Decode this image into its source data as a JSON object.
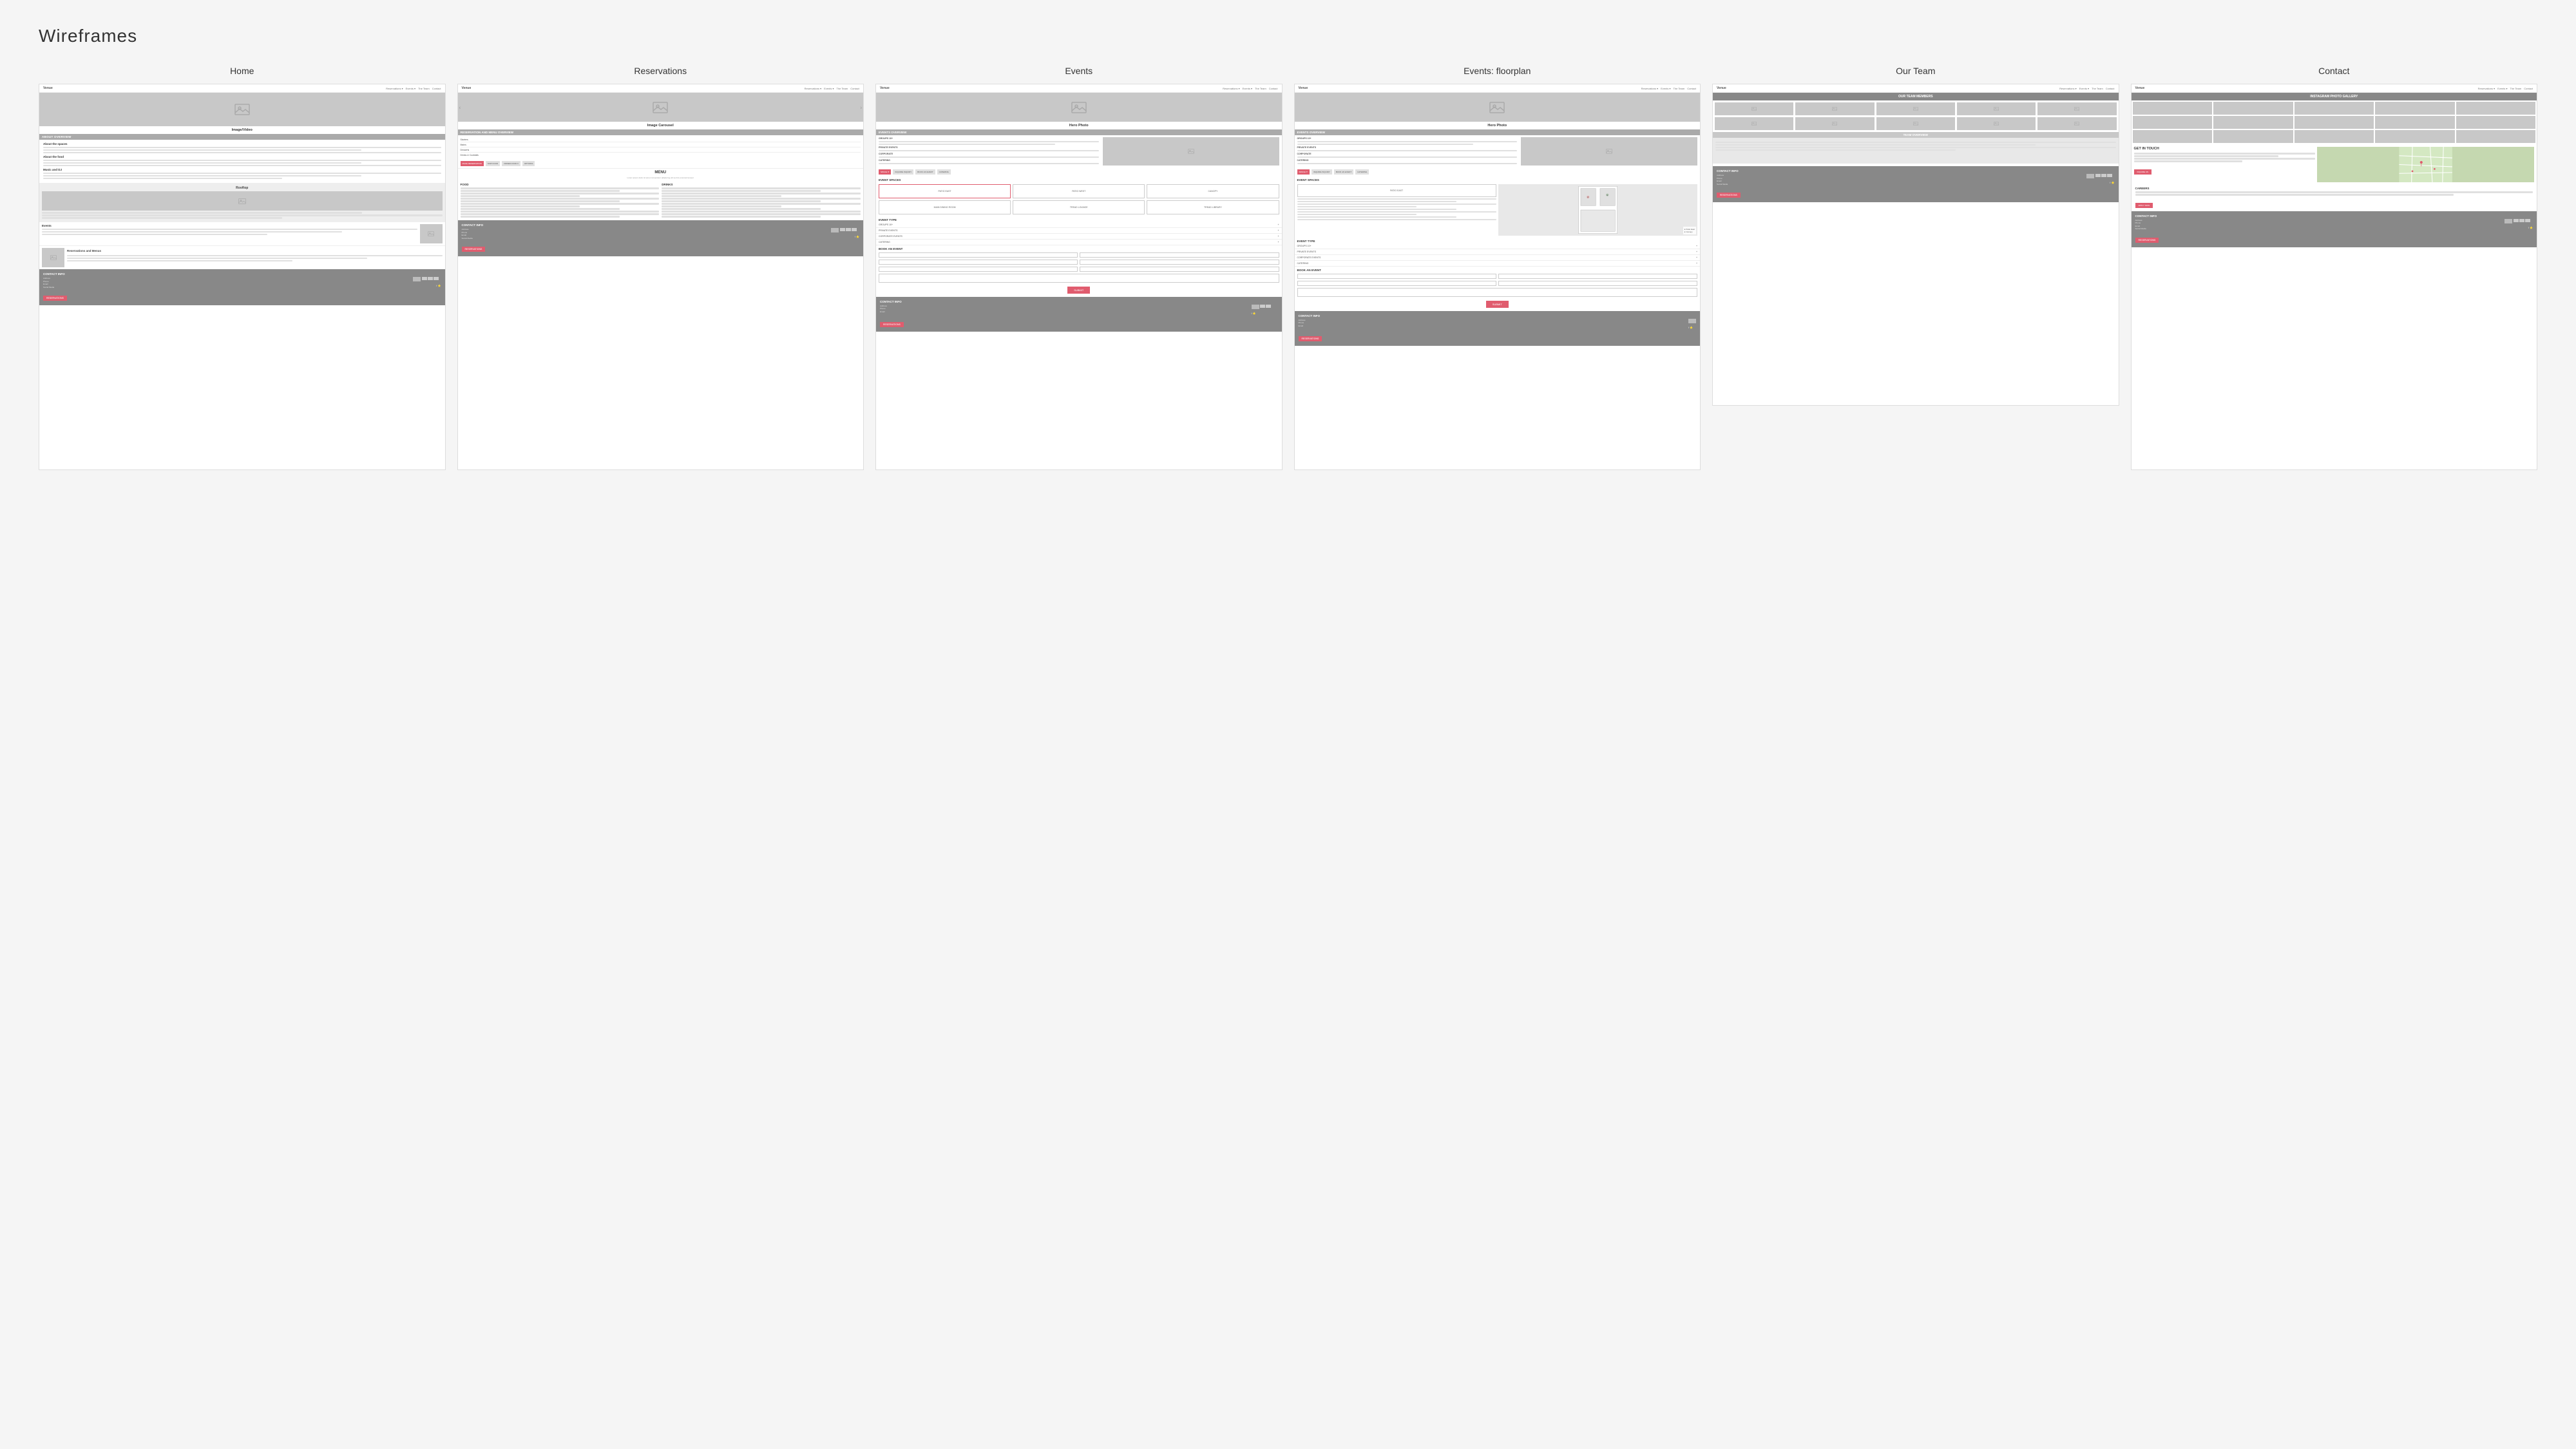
{
  "page": {
    "title": "Wireframes"
  },
  "columns": [
    {
      "id": "home",
      "title": "Home",
      "nav": {
        "logo": "Venue",
        "links": [
          "Reservations ▾",
          "Events ▾",
          "The Team",
          "Contact"
        ]
      },
      "hero": {
        "label": "Image/Video",
        "type": "image"
      },
      "sections": [
        {
          "type": "header",
          "text": "ABOUT OVERVIEW"
        },
        {
          "type": "about-items",
          "items": [
            {
              "label": "About the spaces",
              "lines": 3
            },
            {
              "label": "About the food",
              "lines": 3
            },
            {
              "label": "Music and DJ",
              "lines": 3
            }
          ]
        },
        {
          "type": "rooftop",
          "label": "Rooftop",
          "hasImage": true
        },
        {
          "type": "events-preview",
          "label": "Events",
          "hasImage": true
        },
        {
          "type": "reservations-preview",
          "label": "Reservations and Menus",
          "hasImage": true
        }
      ],
      "footer": {
        "title": "CONTACT INFO",
        "address": "Address\nPhone\nEmail\nSocial Media",
        "hasSocial": true,
        "hasReserveBtn": true
      }
    },
    {
      "id": "reservations",
      "title": "Reservations",
      "nav": {
        "logo": "Venue",
        "links": [
          "Reservations ▾",
          "Events ▾",
          "The Team",
          "Contact"
        ]
      },
      "hero": {
        "label": "Image Carousel",
        "type": "carousel"
      },
      "sections": [
        {
          "type": "header",
          "text": "RESERVATION AND MENU OVERVIEW"
        },
        {
          "type": "dropdown-items",
          "items": [
            "Starters",
            "Mains",
            "Desserts",
            "Drinks & Cocktails"
          ]
        },
        {
          "type": "btn-row",
          "buttons": [
            "MAKE RESERVATION",
            "SKIP FOOD",
            "ORDER FOOD ▾",
            "OPTIONS"
          ]
        },
        {
          "type": "menu-header",
          "text": "MENU"
        },
        {
          "type": "two-col-menu",
          "left": "FOOD",
          "right": "DRINKS"
        }
      ],
      "footer": {
        "title": "CONTACT INFO",
        "address": "Address\nPhone\nEmail\nSocial Media",
        "hasSocial": true,
        "hasReserveBtn": true
      }
    },
    {
      "id": "events",
      "title": "Events",
      "nav": {
        "logo": "Venue",
        "links": [
          "Reservations ▾",
          "Events ▾",
          "The Team",
          "Contact"
        ]
      },
      "hero": {
        "label": "Hero Photo",
        "type": "image"
      },
      "sections": [
        {
          "type": "header",
          "text": "EVENTS OVERVIEW"
        },
        {
          "type": "event-overview-items"
        },
        {
          "type": "btn-row-small",
          "buttons": [
            "SPACE IT",
            "INQUIRE INQUIRY",
            "BOOK AN EVENT",
            "CATERING"
          ]
        },
        {
          "type": "event-spaces-title",
          "text": "EVENT SPACES"
        },
        {
          "type": "event-spaces-grid",
          "spaces": [
            "PATIO EAST",
            "PATIO WEST",
            "CANOPY",
            "MAIN DINING ROOM",
            "TREAD LOUNGE",
            "TREAD LIBRARY"
          ]
        },
        {
          "type": "event-type-title",
          "text": "EVENT TYPE"
        },
        {
          "type": "accordion",
          "items": [
            "GROUPS 10+",
            "PRIVATE EVENTS",
            "CORPORATE EVENTS",
            "CATERING"
          ]
        },
        {
          "type": "book-title",
          "text": "BOOK AN EVENT"
        },
        {
          "type": "event-form"
        }
      ],
      "footer": {
        "title": "CONTACT INFO",
        "hasReserveBtn": true
      }
    },
    {
      "id": "events-floorplan",
      "title": "Events: floorplan",
      "nav": {
        "logo": "Venue",
        "links": [
          "Reservations ▾",
          "Events ▾",
          "The Team",
          "Contact"
        ]
      },
      "hero": {
        "label": "Hero Photo",
        "type": "image"
      },
      "sections": [
        {
          "type": "header",
          "text": "EVENTS OVERVIEW"
        },
        {
          "type": "event-overview-items"
        },
        {
          "type": "btn-row-small",
          "buttons": [
            "SPACE IT",
            "INQUIRE INQUIRY",
            "BOOK AN EVENT",
            "CATERING"
          ]
        },
        {
          "type": "event-spaces-title",
          "text": "EVENT SPACES"
        },
        {
          "type": "event-floorplan-split"
        },
        {
          "type": "event-type-title",
          "text": "EVENT TYPE"
        },
        {
          "type": "accordion",
          "items": [
            "GROUPS 10+",
            "PRIVATE EVENTS",
            "CORPORATE EVENTS",
            "CATERING"
          ]
        },
        {
          "type": "book-title",
          "text": "BOOK AN EVENT"
        },
        {
          "type": "event-form"
        }
      ],
      "footer": {
        "title": "CONTACT INFO",
        "hasReserveBtn": true
      }
    },
    {
      "id": "our-team",
      "title": "Our Team",
      "nav": {
        "logo": "Venue",
        "links": [
          "Reservations ▾",
          "Events ▾",
          "The Team",
          "Contact"
        ]
      },
      "sections": [
        {
          "type": "dark-header",
          "text": "OUR TEAM MEMBERS"
        },
        {
          "type": "team-grid-3x3"
        },
        {
          "type": "team-overview-header",
          "text": "TEAM OVERVIEW"
        },
        {
          "type": "team-overview-text"
        }
      ],
      "footer": {
        "title": "CONTACT INFO",
        "hasSocial": true,
        "hasReserveBtn": true
      }
    },
    {
      "id": "contact",
      "title": "Contact",
      "nav": {
        "logo": "Venue",
        "links": [
          "Reservations ▾",
          "Events ▾",
          "The Team",
          "Contact"
        ]
      },
      "sections": [
        {
          "type": "dark-header",
          "text": "INSTAGRAM PHOTO GALLERY"
        },
        {
          "type": "gallery-grid"
        },
        {
          "type": "get-in-touch-map",
          "getInTouchTitle": "GET IN TOUCH"
        },
        {
          "type": "careers",
          "title": "CAREERS"
        },
        {
          "type": "contact-info-dark",
          "title": "CONTACT INFO"
        }
      ]
    }
  ]
}
